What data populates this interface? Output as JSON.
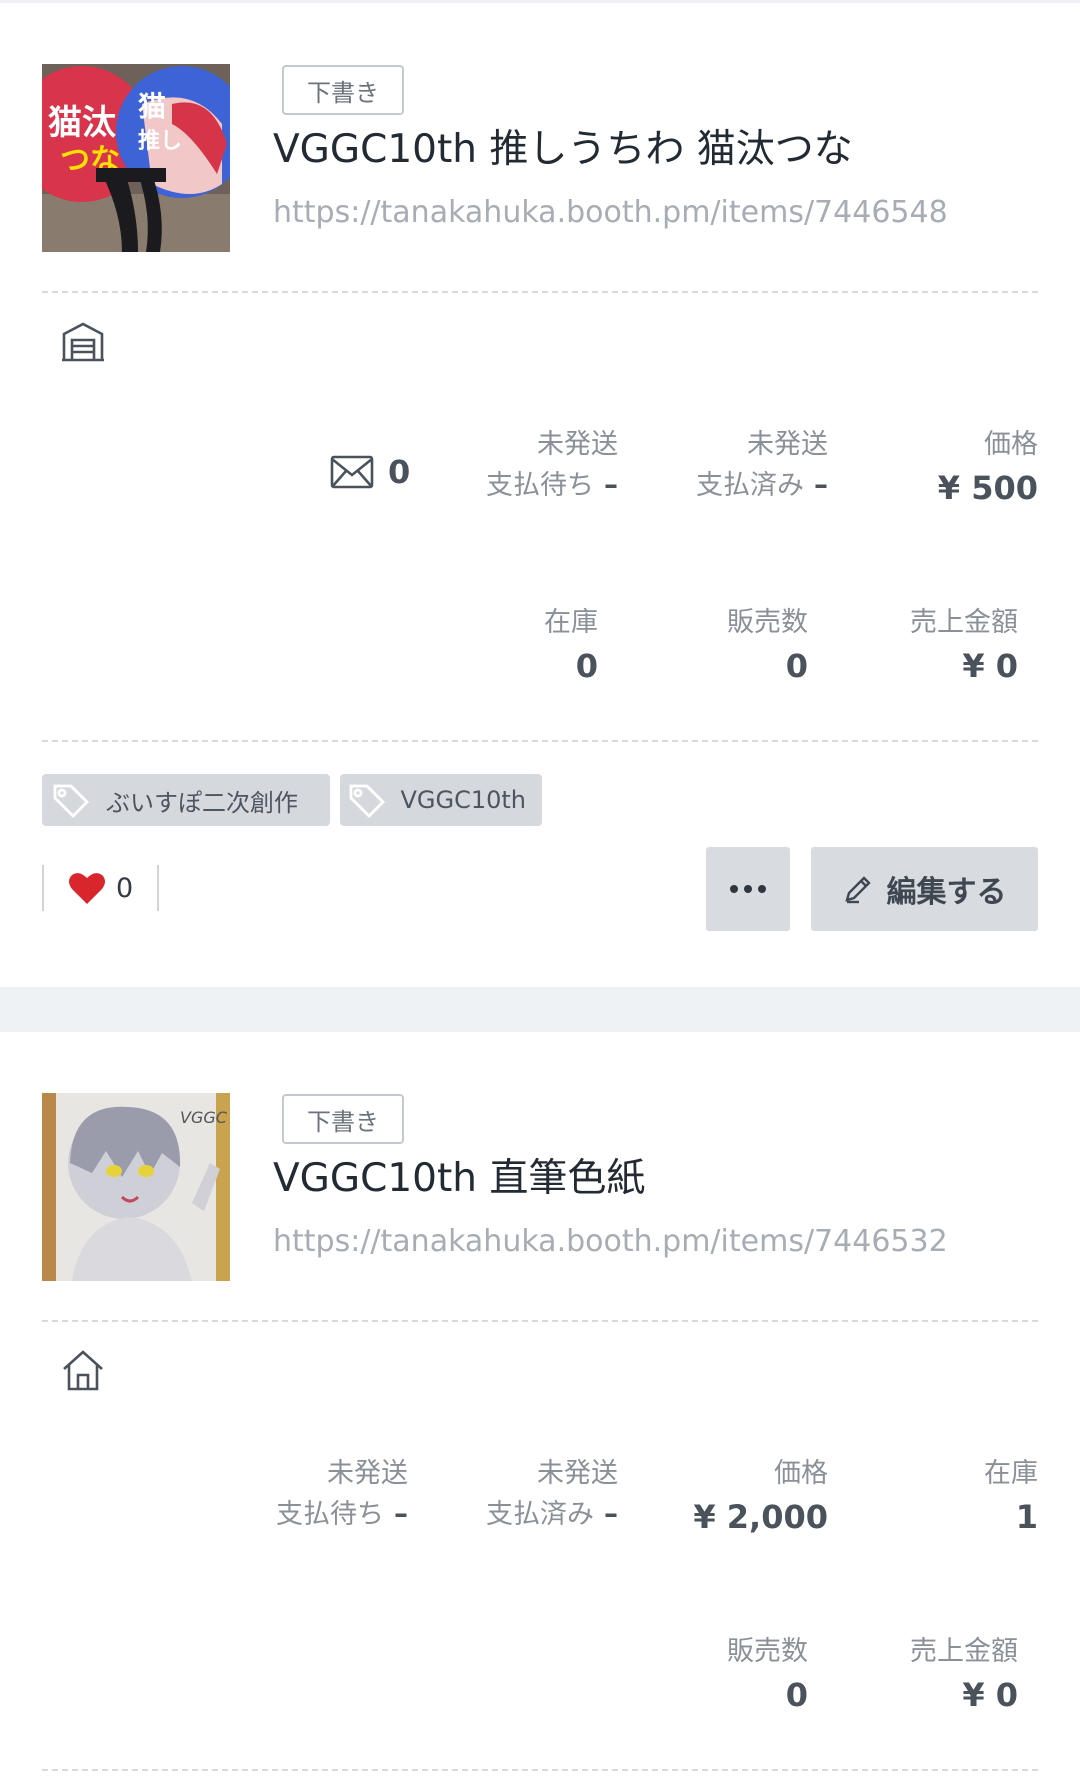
{
  "items": [
    {
      "status_badge": "下書き",
      "title": "VGGC10th 推しうちわ 猫汰つな",
      "url": "https://tanakahuka.booth.pm/items/7446548",
      "shipping_icon": "warehouse-icon",
      "messages_count": "0",
      "unshipped_waiting": {
        "label": "未発送",
        "sub": "支払待ち",
        "value": "–"
      },
      "unshipped_paid": {
        "label": "未発送",
        "sub": "支払済み",
        "value": "–"
      },
      "price": {
        "label": "価格",
        "value": "¥ 500"
      },
      "stock": {
        "label": "在庫",
        "value": "0"
      },
      "sold": {
        "label": "販売数",
        "value": "0"
      },
      "sales": {
        "label": "売上金額",
        "value": "¥ 0"
      },
      "tags": [
        "ぶいすぽ二次創作",
        "VGGC10th"
      ],
      "likes": "0",
      "edit_label": "編集する"
    },
    {
      "status_badge": "下書き",
      "title": "VGGC10th 直筆色紙",
      "url": "https://tanakahuka.booth.pm/items/7446532",
      "shipping_icon": "home-icon",
      "unshipped_waiting": {
        "label": "未発送",
        "sub": "支払待ち",
        "value": "–"
      },
      "unshipped_paid": {
        "label": "未発送",
        "sub": "支払済み",
        "value": "–"
      },
      "price": {
        "label": "価格",
        "value": "¥ 2,000"
      },
      "stock": {
        "label": "在庫",
        "value": "1"
      },
      "sold": {
        "label": "販売数",
        "value": "0"
      },
      "sales": {
        "label": "売上金額",
        "value": "¥ 0"
      }
    }
  ],
  "colors": {
    "heart": "#d9262c",
    "tag_bg": "#d5d9de",
    "button_bg": "#d8dce0",
    "divider_band": "#eef2f5"
  },
  "thumbnail_text": {
    "item1_fan_left": "猫汰つな",
    "item1_fan_right": "猫推し",
    "item2_sign": "VGGC"
  }
}
